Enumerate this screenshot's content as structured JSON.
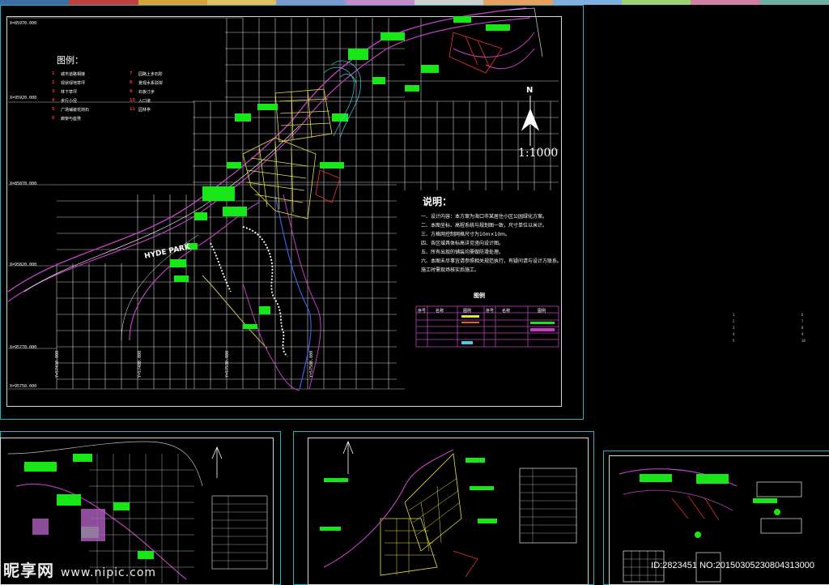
{
  "top_colors": [
    "#3a6ea5",
    "#c04040",
    "#d6a23a",
    "#e0c060",
    "#7a9ad0",
    "#c58acb",
    "#d0d0d0",
    "#e8a060",
    "#80b0e0",
    "#9ad07a",
    "#d080a0",
    "#6fb0a0"
  ],
  "main_sheet": {
    "legend_title": "图例：",
    "legend_items": [
      {
        "num": "1",
        "label": "城市道路相接"
      },
      {
        "num": "2",
        "label": "现状绿地草坪"
      },
      {
        "num": "3",
        "label": "林下草坪"
      },
      {
        "num": "4",
        "label": "步行小径"
      },
      {
        "num": "5",
        "label": "广场铺装花岗石"
      },
      {
        "num": "6",
        "label": "廊架与座凳"
      },
      {
        "num": "7",
        "label": "园路土步石阶"
      },
      {
        "num": "8",
        "label": "景观水系驳岸"
      },
      {
        "num": "9",
        "label": "石板汀步"
      },
      {
        "num": "10",
        "label": "入口道"
      },
      {
        "num": "11",
        "label": "园林亭"
      }
    ],
    "coords_left": [
      "X=85970.000",
      "X=95920.000",
      "X=85870.000",
      "X=95820.000",
      "X=95770.000",
      "X=95750.000"
    ],
    "coords_bottom": [
      "Y=57430.000",
      "Y=57480.000",
      "Y=57530.000",
      "Y=57580.000"
    ],
    "park_label": "HYDE PARK",
    "north": "N",
    "scale": "1:1000",
    "notes_title": "说明：",
    "notes": [
      "一、设计内容：本方案为海口市某居住小区公园绿化方案。",
      "二、本图坐标、高程系统与规划图一致，尺寸单位以米计。",
      "三、方格网控制网格尺寸为10m×10m。",
      "四、各区域具体标高详见竖向设计图。",
      "五、所有出现的铺装均需做防滑处理。",
      "六、本图未尽事宜请参照相关规范执行，有疑问请与设计方联系。",
      "    施工时需现场核实后施工。"
    ],
    "table_title": "图例",
    "table_headers": [
      "序号",
      "名称",
      "图例",
      "序号",
      "名称",
      "图例"
    ]
  },
  "side_nums": [
    "1",
    "2",
    "3",
    "4",
    "5",
    "6",
    "7",
    "8",
    "9",
    "10"
  ],
  "watermark": {
    "brand": "昵享网",
    "url": "www.nipic.com"
  },
  "image_id": "ID:2823451 NO:20150305230804313000"
}
